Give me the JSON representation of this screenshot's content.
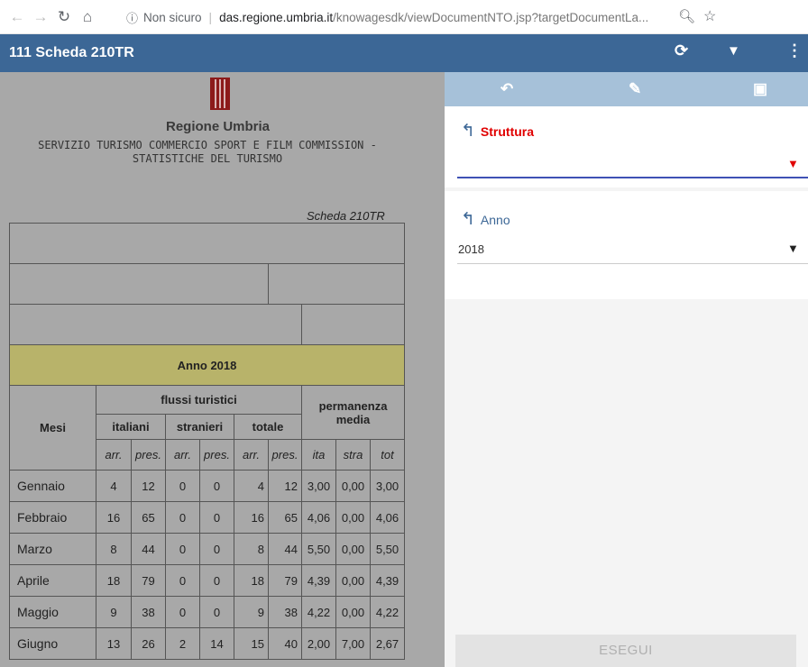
{
  "browser": {
    "info_icon": "info-circle-icon",
    "security_text": "Non sicuro",
    "url_host": "das.regione.umbria.it",
    "url_path": "/knowagesdk/viewDocumentNTO.jsp?targetDocumentLa..."
  },
  "header": {
    "title": "111 Scheda 210TR",
    "icons": [
      "refresh-icon",
      "filter-icon",
      "more-vertical-icon"
    ]
  },
  "document": {
    "org": "Regione Umbria",
    "service_line1": "SERVIZIO TURISMO COMMERCIO SPORT E FILM COMMISSION -",
    "service_line2": "STATISTICHE DEL TURISMO",
    "scheda": "Scheda 210TR",
    "anno_title": "Anno 2018",
    "headers": {
      "mesi": "Mesi",
      "flussi": "flussi turistici",
      "permanenza_line1": "permanenza",
      "permanenza_line2": "media",
      "italiani": "italiani",
      "stranieri": "stranieri",
      "totale": "totale",
      "arr": "arr.",
      "pres": "pres.",
      "ita": "ita",
      "stra": "stra",
      "tot": "tot"
    },
    "rows": [
      {
        "month": "Gennaio",
        "vals": [
          "4",
          "12",
          "0",
          "0",
          "4",
          "12",
          "3,00",
          "0,00",
          "3,00"
        ]
      },
      {
        "month": "Febbraio",
        "vals": [
          "16",
          "65",
          "0",
          "0",
          "16",
          "65",
          "4,06",
          "0,00",
          "4,06"
        ]
      },
      {
        "month": "Marzo",
        "vals": [
          "8",
          "44",
          "0",
          "0",
          "8",
          "44",
          "5,50",
          "0,00",
          "5,50"
        ]
      },
      {
        "month": "Aprile",
        "vals": [
          "18",
          "79",
          "0",
          "0",
          "18",
          "79",
          "4,39",
          "0,00",
          "4,39"
        ]
      },
      {
        "month": "Maggio",
        "vals": [
          "9",
          "38",
          "0",
          "0",
          "9",
          "38",
          "4,22",
          "0,00",
          "4,22"
        ]
      },
      {
        "month": "Giugno",
        "vals": [
          "13",
          "26",
          "2",
          "14",
          "15",
          "40",
          "2,00",
          "7,00",
          "2,67"
        ]
      }
    ]
  },
  "panel": {
    "tools": [
      "undo-icon",
      "edit-pencil-icon",
      "save-icon"
    ],
    "filters": [
      {
        "label": "Struttura",
        "value": "",
        "label_color": "#e00000",
        "caret_color": "#e00000"
      },
      {
        "label": "Anno",
        "value": "2018",
        "label_color": "#3c6796",
        "caret_color": "#222222"
      }
    ],
    "execute_label": "ESEGUI"
  },
  "colors": {
    "header_bg": "#3c6796",
    "toolbar_bg": "#a6c1d9",
    "doc_bg": "#a8a8a8",
    "anno_bg": "#b8b36a",
    "active_underline": "#3f51b5",
    "required_red": "#e00000"
  }
}
